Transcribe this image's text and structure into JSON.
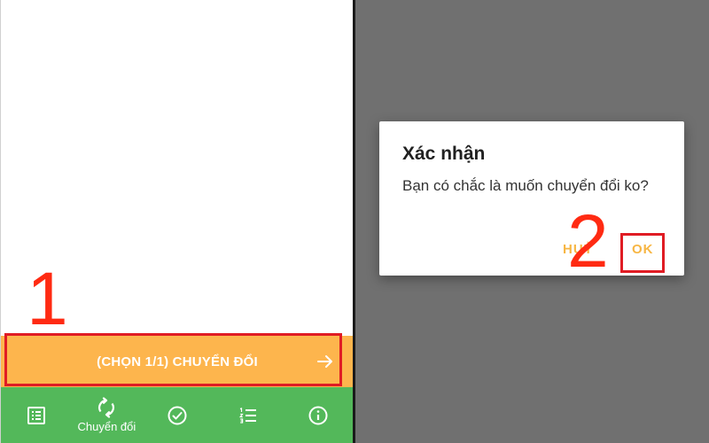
{
  "left_screen": {
    "convert_button": {
      "label": "(CHỌN 1/1) CHUYỂN ĐỔI",
      "icon": "arrow-right-icon"
    },
    "bottom_nav": [
      {
        "icon": "list-icon",
        "label": ""
      },
      {
        "icon": "sync-icon",
        "label": "Chuyển đổi"
      },
      {
        "icon": "check-circle-icon",
        "label": ""
      },
      {
        "icon": "numbered-list-icon",
        "label": ""
      },
      {
        "icon": "info-icon",
        "label": ""
      }
    ],
    "annotation": "1"
  },
  "right_screen": {
    "dialog": {
      "title": "Xác nhận",
      "message": "Bạn có chắc là muốn chuyển đổi ko?",
      "cancel_label": "HUỶ",
      "ok_label": "OK"
    },
    "annotation": "2"
  },
  "colors": {
    "accent_orange": "#fdb54d",
    "nav_green": "#53b85a",
    "annotation_red": "#ff2a12",
    "overlay_gray": "#707070",
    "dialog_button": "#f7b644"
  }
}
